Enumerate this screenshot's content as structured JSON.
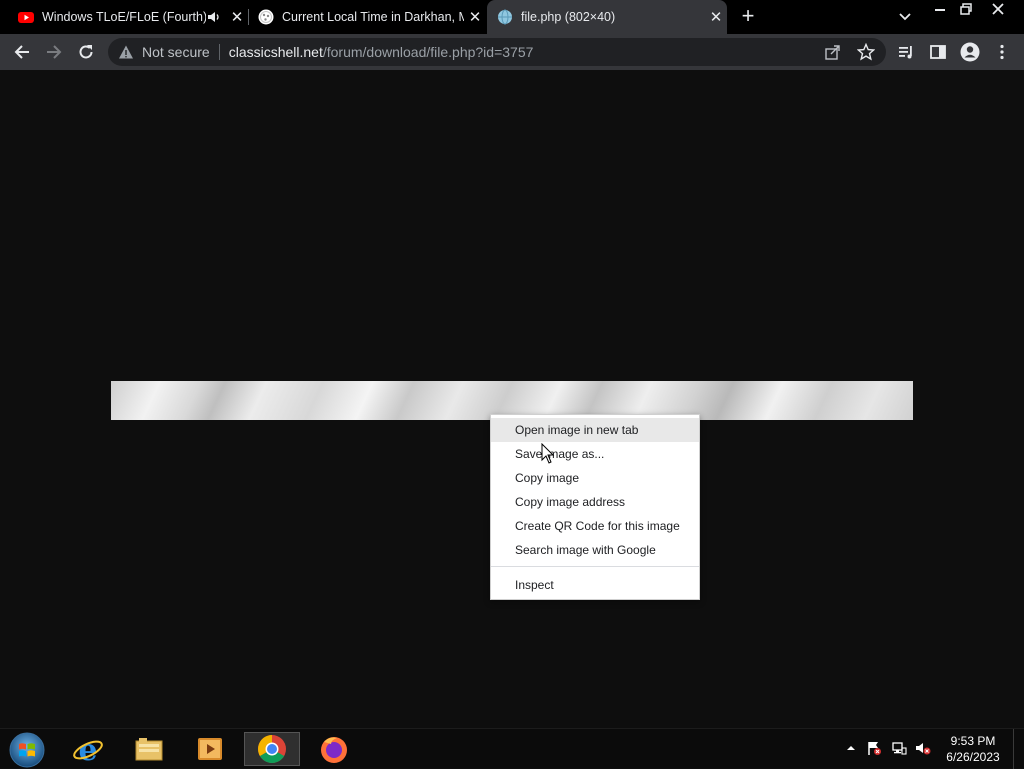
{
  "tabs": [
    {
      "title": "Windows TLoE/FLoE (Fourth)",
      "favicon": "youtube-icon",
      "audio": true
    },
    {
      "title": "Current Local Time in Darkhan, M",
      "favicon": "clock-site-icon",
      "audio": false
    },
    {
      "title": "file.php (802×40)",
      "favicon": "globe-icon",
      "audio": false,
      "active": true
    }
  ],
  "toolbar": {
    "security_label": "Not secure",
    "url_host": "classicshell.net",
    "url_path": "/forum/download/file.php?id=3757"
  },
  "context_menu": {
    "items": [
      "Open image in new tab",
      "Save image as...",
      "Copy image",
      "Copy image address",
      "Create QR Code for this image",
      "Search image with Google"
    ],
    "inspect": "Inspect",
    "hovered_index": 0
  },
  "taskbar": {
    "apps": [
      "internet-explorer-icon",
      "file-explorer-icon",
      "media-player-icon",
      "chrome-icon",
      "firefox-icon"
    ],
    "clock_time": "9:53 PM",
    "clock_date": "6/26/2023"
  },
  "colors": {
    "tab_strip": "#000000",
    "toolbar": "#35363a",
    "omnibox": "#202124",
    "page_bg": "#0e0e0e",
    "menu_bg": "#ffffff",
    "menu_hover": "#e8e8e8"
  }
}
